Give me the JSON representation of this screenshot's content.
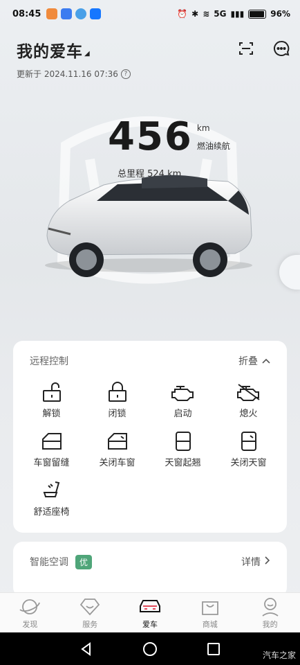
{
  "status": {
    "time": "08:45",
    "battery": "96%",
    "battery_level": 0.96,
    "network": "5G"
  },
  "header": {
    "title": "我的爱车",
    "updated": "更新于 2024.11.16 07:36"
  },
  "hero": {
    "range_value": "456",
    "range_unit": "km",
    "range_label": "燃油续航",
    "odometer": "总里程 524 km"
  },
  "remote": {
    "title": "远程控制",
    "collapse_label": "折叠",
    "controls": [
      {
        "label": "解锁",
        "icon": "unlock-icon"
      },
      {
        "label": "闭锁",
        "icon": "lock-icon"
      },
      {
        "label": "启动",
        "icon": "engine-start-icon"
      },
      {
        "label": "熄火",
        "icon": "engine-off-icon"
      },
      {
        "label": "车窗留缝",
        "icon": "window-vent-icon"
      },
      {
        "label": "关闭车窗",
        "icon": "window-close-icon"
      },
      {
        "label": "天窗起翘",
        "icon": "sunroof-tilt-icon"
      },
      {
        "label": "关闭天窗",
        "icon": "sunroof-close-icon"
      },
      {
        "label": "舒适座椅",
        "icon": "seat-icon"
      }
    ]
  },
  "climate": {
    "title": "智能空调",
    "badge": "优",
    "detail_label": "详情"
  },
  "tabs": [
    {
      "label": "发现",
      "icon": "planet-icon"
    },
    {
      "label": "服务",
      "icon": "service-icon"
    },
    {
      "label": "爱车",
      "icon": "car-icon"
    },
    {
      "label": "商城",
      "icon": "shop-icon"
    },
    {
      "label": "我的",
      "icon": "profile-icon"
    }
  ],
  "watermark": "汽车之家",
  "colors": {
    "accent_green": "#4fa579"
  }
}
